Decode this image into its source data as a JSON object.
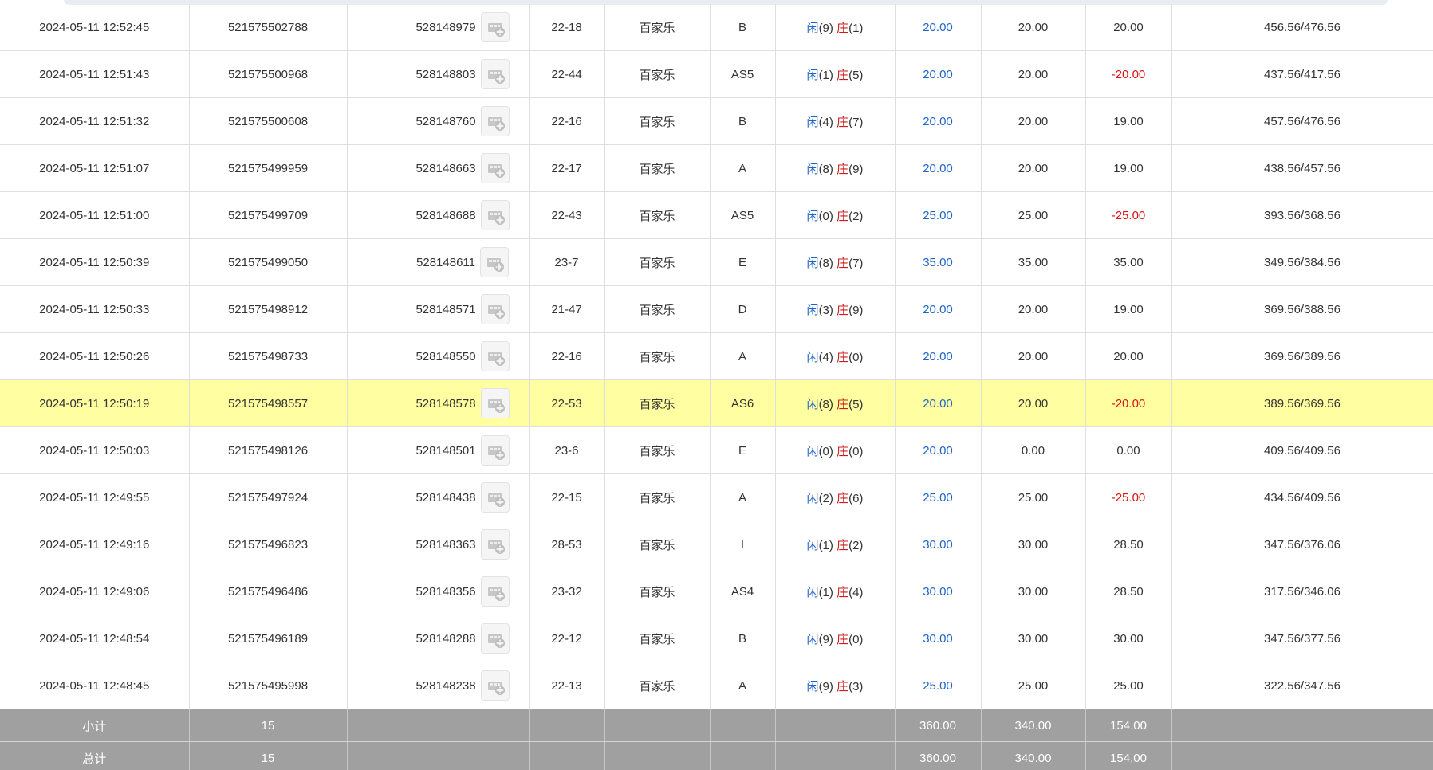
{
  "colors": {
    "row_highlight": "#ffffa1",
    "summary_background": "#a0a0a0",
    "player_blue": "#1e63c8",
    "banker_red": "#d11b1b",
    "negative_red": "#e01010"
  },
  "icons": {
    "replay": "video-replay-icon"
  },
  "rows": [
    {
      "time": "2024-05-11 12:52:45",
      "bet_id": "521575502788",
      "round_id": "528148979",
      "table_shoe": "22-18",
      "game": "百家乐",
      "table": "B",
      "player_label": "闲",
      "player_points": "(9)",
      "banker_label": "庄",
      "banker_points": "(1)",
      "bet_amount": "20.00",
      "valid_bet": "20.00",
      "payout": "20.00",
      "payout_negative": false,
      "balance": "456.56/476.56",
      "highlight": false
    },
    {
      "time": "2024-05-11 12:51:43",
      "bet_id": "521575500968",
      "round_id": "528148803",
      "table_shoe": "22-44",
      "game": "百家乐",
      "table": "AS5",
      "player_label": "闲",
      "player_points": "(1)",
      "banker_label": "庄",
      "banker_points": "(5)",
      "bet_amount": "20.00",
      "valid_bet": "20.00",
      "payout": "-20.00",
      "payout_negative": true,
      "balance": "437.56/417.56",
      "highlight": false
    },
    {
      "time": "2024-05-11 12:51:32",
      "bet_id": "521575500608",
      "round_id": "528148760",
      "table_shoe": "22-16",
      "game": "百家乐",
      "table": "B",
      "player_label": "闲",
      "player_points": "(4)",
      "banker_label": "庄",
      "banker_points": "(7)",
      "bet_amount": "20.00",
      "valid_bet": "20.00",
      "payout": "19.00",
      "payout_negative": false,
      "balance": "457.56/476.56",
      "highlight": false
    },
    {
      "time": "2024-05-11 12:51:07",
      "bet_id": "521575499959",
      "round_id": "528148663",
      "table_shoe": "22-17",
      "game": "百家乐",
      "table": "A",
      "player_label": "闲",
      "player_points": "(8)",
      "banker_label": "庄",
      "banker_points": "(9)",
      "bet_amount": "20.00",
      "valid_bet": "20.00",
      "payout": "19.00",
      "payout_negative": false,
      "balance": "438.56/457.56",
      "highlight": false
    },
    {
      "time": "2024-05-11 12:51:00",
      "bet_id": "521575499709",
      "round_id": "528148688",
      "table_shoe": "22-43",
      "game": "百家乐",
      "table": "AS5",
      "player_label": "闲",
      "player_points": "(0)",
      "banker_label": "庄",
      "banker_points": "(2)",
      "bet_amount": "25.00",
      "valid_bet": "25.00",
      "payout": "-25.00",
      "payout_negative": true,
      "balance": "393.56/368.56",
      "highlight": false
    },
    {
      "time": "2024-05-11 12:50:39",
      "bet_id": "521575499050",
      "round_id": "528148611",
      "table_shoe": "23-7",
      "game": "百家乐",
      "table": "E",
      "player_label": "闲",
      "player_points": "(8)",
      "banker_label": "庄",
      "banker_points": "(7)",
      "bet_amount": "35.00",
      "valid_bet": "35.00",
      "payout": "35.00",
      "payout_negative": false,
      "balance": "349.56/384.56",
      "highlight": false
    },
    {
      "time": "2024-05-11 12:50:33",
      "bet_id": "521575498912",
      "round_id": "528148571",
      "table_shoe": "21-47",
      "game": "百家乐",
      "table": "D",
      "player_label": "闲",
      "player_points": "(3)",
      "banker_label": "庄",
      "banker_points": "(9)",
      "bet_amount": "20.00",
      "valid_bet": "20.00",
      "payout": "19.00",
      "payout_negative": false,
      "balance": "369.56/388.56",
      "highlight": false
    },
    {
      "time": "2024-05-11 12:50:26",
      "bet_id": "521575498733",
      "round_id": "528148550",
      "table_shoe": "22-16",
      "game": "百家乐",
      "table": "A",
      "player_label": "闲",
      "player_points": "(4)",
      "banker_label": "庄",
      "banker_points": "(0)",
      "bet_amount": "20.00",
      "valid_bet": "20.00",
      "payout": "20.00",
      "payout_negative": false,
      "balance": "369.56/389.56",
      "highlight": false
    },
    {
      "time": "2024-05-11 12:50:19",
      "bet_id": "521575498557",
      "round_id": "528148578",
      "table_shoe": "22-53",
      "game": "百家乐",
      "table": "AS6",
      "player_label": "闲",
      "player_points": "(8)",
      "banker_label": "庄",
      "banker_points": "(5)",
      "bet_amount": "20.00",
      "valid_bet": "20.00",
      "payout": "-20.00",
      "payout_negative": true,
      "balance": "389.56/369.56",
      "highlight": true
    },
    {
      "time": "2024-05-11 12:50:03",
      "bet_id": "521575498126",
      "round_id": "528148501",
      "table_shoe": "23-6",
      "game": "百家乐",
      "table": "E",
      "player_label": "闲",
      "player_points": "(0)",
      "banker_label": "庄",
      "banker_points": "(0)",
      "bet_amount": "20.00",
      "valid_bet": "0.00",
      "payout": "0.00",
      "payout_negative": false,
      "balance": "409.56/409.56",
      "highlight": false
    },
    {
      "time": "2024-05-11 12:49:55",
      "bet_id": "521575497924",
      "round_id": "528148438",
      "table_shoe": "22-15",
      "game": "百家乐",
      "table": "A",
      "player_label": "闲",
      "player_points": "(2)",
      "banker_label": "庄",
      "banker_points": "(6)",
      "bet_amount": "25.00",
      "valid_bet": "25.00",
      "payout": "-25.00",
      "payout_negative": true,
      "balance": "434.56/409.56",
      "highlight": false
    },
    {
      "time": "2024-05-11 12:49:16",
      "bet_id": "521575496823",
      "round_id": "528148363",
      "table_shoe": "28-53",
      "game": "百家乐",
      "table": "I",
      "player_label": "闲",
      "player_points": "(1)",
      "banker_label": "庄",
      "banker_points": "(2)",
      "bet_amount": "30.00",
      "valid_bet": "30.00",
      "payout": "28.50",
      "payout_negative": false,
      "balance": "347.56/376.06",
      "highlight": false
    },
    {
      "time": "2024-05-11 12:49:06",
      "bet_id": "521575496486",
      "round_id": "528148356",
      "table_shoe": "23-32",
      "game": "百家乐",
      "table": "AS4",
      "player_label": "闲",
      "player_points": "(1)",
      "banker_label": "庄",
      "banker_points": "(4)",
      "bet_amount": "30.00",
      "valid_bet": "30.00",
      "payout": "28.50",
      "payout_negative": false,
      "balance": "317.56/346.06",
      "highlight": false
    },
    {
      "time": "2024-05-11 12:48:54",
      "bet_id": "521575496189",
      "round_id": "528148288",
      "table_shoe": "22-12",
      "game": "百家乐",
      "table": "B",
      "player_label": "闲",
      "player_points": "(9)",
      "banker_label": "庄",
      "banker_points": "(0)",
      "bet_amount": "30.00",
      "valid_bet": "30.00",
      "payout": "30.00",
      "payout_negative": false,
      "balance": "347.56/377.56",
      "highlight": false
    },
    {
      "time": "2024-05-11 12:48:45",
      "bet_id": "521575495998",
      "round_id": "528148238",
      "table_shoe": "22-13",
      "game": "百家乐",
      "table": "A",
      "player_label": "闲",
      "player_points": "(9)",
      "banker_label": "庄",
      "banker_points": "(3)",
      "bet_amount": "25.00",
      "valid_bet": "25.00",
      "payout": "25.00",
      "payout_negative": false,
      "balance": "322.56/347.56",
      "highlight": false
    }
  ],
  "summary": {
    "subtotal": {
      "label": "小计",
      "count": "15",
      "bet_amount": "360.00",
      "valid_bet": "340.00",
      "payout": "154.00"
    },
    "total": {
      "label": "总计",
      "count": "15",
      "bet_amount": "360.00",
      "valid_bet": "340.00",
      "payout": "154.00"
    }
  }
}
